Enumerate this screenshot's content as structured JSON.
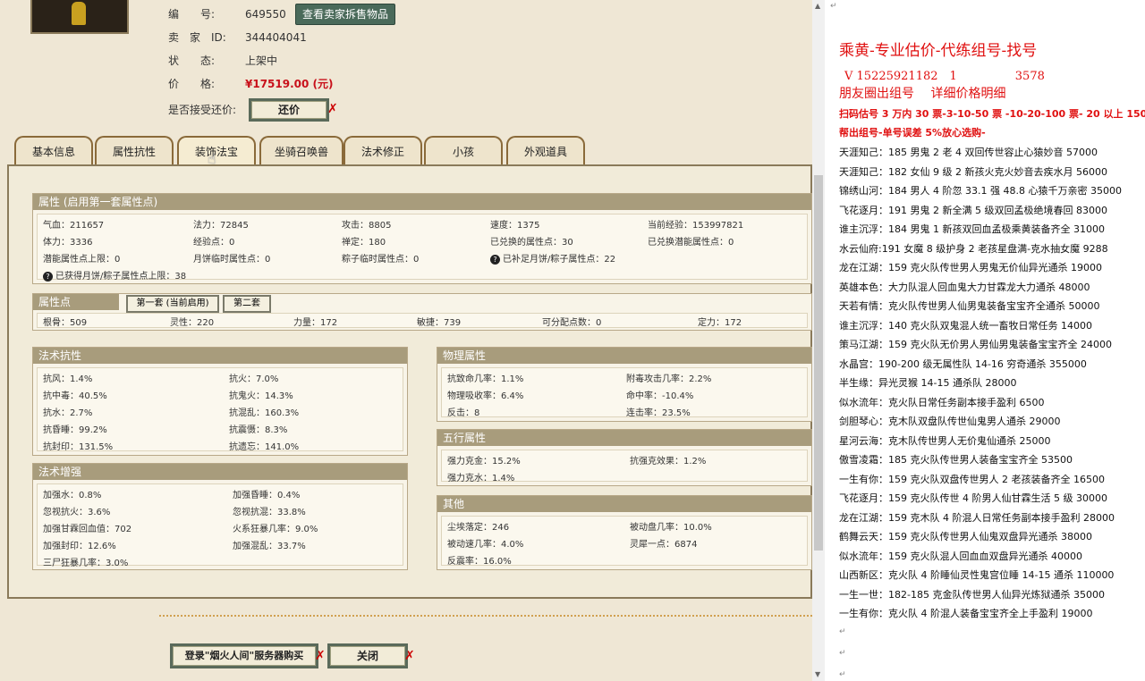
{
  "game": {
    "info": {
      "id_label": "编　　号:",
      "id_value": "649550",
      "seller_btn": "查看卖家拆售物品",
      "seller_label": "卖　家　ID:",
      "seller_value": "344404041",
      "status_label": "状　　态:",
      "status_value": "上架中",
      "price_label": "价　　格:",
      "price_value": "¥17519.00 (元)",
      "counter_label": "是否接受还价:",
      "counter_btn": "还价"
    },
    "tabs": [
      "基本信息",
      "属性抗性",
      "装饰法宝",
      "坐骑召唤兽",
      "法术修正",
      "小孩",
      "外观道具"
    ],
    "attr": {
      "title": "属性 (启用第一套属性点)",
      "rows": [
        [
          "气血：211657",
          "法力：72845",
          "攻击：8805",
          "速度：1375",
          "当前经验：153997821"
        ],
        [
          "体力：3336",
          "经验点：0",
          "禅定：180",
          "已兑换的属性点：30",
          "已兑换潜能属性点：0"
        ],
        [
          "潜能属性点上限：0",
          "月饼临时属性点：0",
          "粽子临时属性点：0",
          "已补足月饼/粽子属性点：22"
        ]
      ],
      "note": "已获得月饼/粽子属性点上限：38"
    },
    "points": {
      "title": "属性点",
      "tab1": "第一套 (当前启用)",
      "tab2": "第二套",
      "values": [
        "根骨：509",
        "灵性：220",
        "力量：172",
        "敏捷：739",
        "可分配点数：0",
        "定力：172"
      ]
    },
    "resist": {
      "title": "法术抗性",
      "rows": [
        [
          "抗风：1.4%",
          "抗火：7.0%"
        ],
        [
          "抗中毒：40.5%",
          "抗鬼火：14.3%"
        ],
        [
          "抗水：2.7%",
          "抗混乱：160.3%"
        ],
        [
          "抗昏睡：99.2%",
          "抗震慑：8.3%"
        ],
        [
          "抗封印：131.5%",
          "抗遗忘：141.0%"
        ]
      ]
    },
    "enhance": {
      "title": "法术增强",
      "rows": [
        [
          "加强水：0.8%",
          "加强昏睡：0.4%"
        ],
        [
          "忽视抗火：3.6%",
          "忽视抗混：33.8%"
        ],
        [
          "加强甘霖回血值：702",
          "火系狂暴几率：9.0%"
        ],
        [
          "加强封印：12.6%",
          "加强混乱：33.7%"
        ],
        [
          "三尸狂暴几率：3.0%",
          ""
        ]
      ]
    },
    "physical": {
      "title": "物理属性",
      "rows": [
        [
          "抗致命几率：1.1%",
          "附毒攻击几率：2.2%"
        ],
        [
          "物理吸收率：6.4%",
          "命中率：-10.4%"
        ],
        [
          "反击：8",
          "连击率：23.5%"
        ]
      ]
    },
    "five": {
      "title": "五行属性",
      "rows": [
        [
          "强力克金：15.2%",
          "抗强克效果：1.2%"
        ],
        [
          "强力克水：1.4%",
          ""
        ]
      ]
    },
    "other": {
      "title": "其他",
      "rows": [
        [
          "尘埃落定：246",
          "被动盘几率：10.0%"
        ],
        [
          "被动速几率：4.0%",
          "灵犀一点：6874"
        ],
        [
          "反震率：16.0%",
          ""
        ]
      ]
    },
    "bottom": {
      "login_btn": "登录\"烟火人间\"服务器购买",
      "close_btn": "关闭"
    }
  },
  "doc": {
    "title": "乘黄-专业估价-代练组号-找号",
    "phone": "V 15225921182　1　　　　　3578",
    "sub": "朋友圈出组号　 详细价格明细",
    "red1": "扫码估号 3 万内 30 票-3-10-50 票 -10-20-100 票- 20 以上 150",
    "red2": "帮出组号-单号误差 5%放心选购-",
    "lines": [
      "天涯知己：185 男鬼 2 老 4 双回传世容止心猿妙音 57000",
      "天涯知己：182 女仙 9 级 2 新孩火克火妙音去疾水月 56000",
      "锦绣山河：184 男人 4 阶忽 33.1 强 48.8 心猿千万亲密 35000",
      "飞花逐月：191 男鬼 2 新全满 5 级双回孟极绝境春回 83000",
      "谁主沉浮：184 男鬼 1 新孩双回血孟极乘黄装备齐全 31000",
      "水云仙府:191 女魔 8 级护身 2 老孩星盘满-克水抽女魔 9288",
      "龙在江湖：159 克火队传世男人男鬼无价仙异光通杀 19000",
      "英雄本色：大力队混人回血鬼大力甘霖龙大力通杀 48000",
      "天若有情：克火队传世男人仙男鬼装备宝宝齐全通杀 50000",
      "谁主沉浮：140 克火队双鬼混人统一畜牧日常任务 14000",
      "策马江湖：159 克火队无价男人男仙男鬼装备宝宝齐全 24000",
      "水晶宫：190-200 级无属性队 14-16 穷奇通杀 355000",
      "半生缘：异光灵猴 14-15 通杀队 28000",
      "似水流年：克火队日常任务副本接手盈利 6500",
      "剑胆琴心：克木队双盘队传世仙鬼男人通杀 29000",
      "星河云海：克木队传世男人无价鬼仙通杀 25000",
      "傲雪凌霜：185 克火队传世男人装备宝宝齐全 53500",
      "一生有你：159 克火队双盘传世男人 2 老孩装备齐全 16500",
      "飞花逐月：159 克火队传世 4 阶男人仙甘霖生活 5 级 30000",
      "龙在江湖：159 克木队 4 阶混人日常任务副本接手盈利 28000",
      "鹤舞云天：159 克火队传世男人仙鬼双盘异光通杀 38000",
      "似水流年：159 克火队混人回血血双盘异光通杀 40000",
      "山西新区：克火队 4 阶睡仙灵性鬼宫位睡 14-15 通杀 110000",
      "一生一世：182-185 克金队传世男人仙异光炼狱通杀 35000",
      "一生有你：克火队 4 阶混人装备宝宝齐全上手盈利 19000"
    ]
  }
}
